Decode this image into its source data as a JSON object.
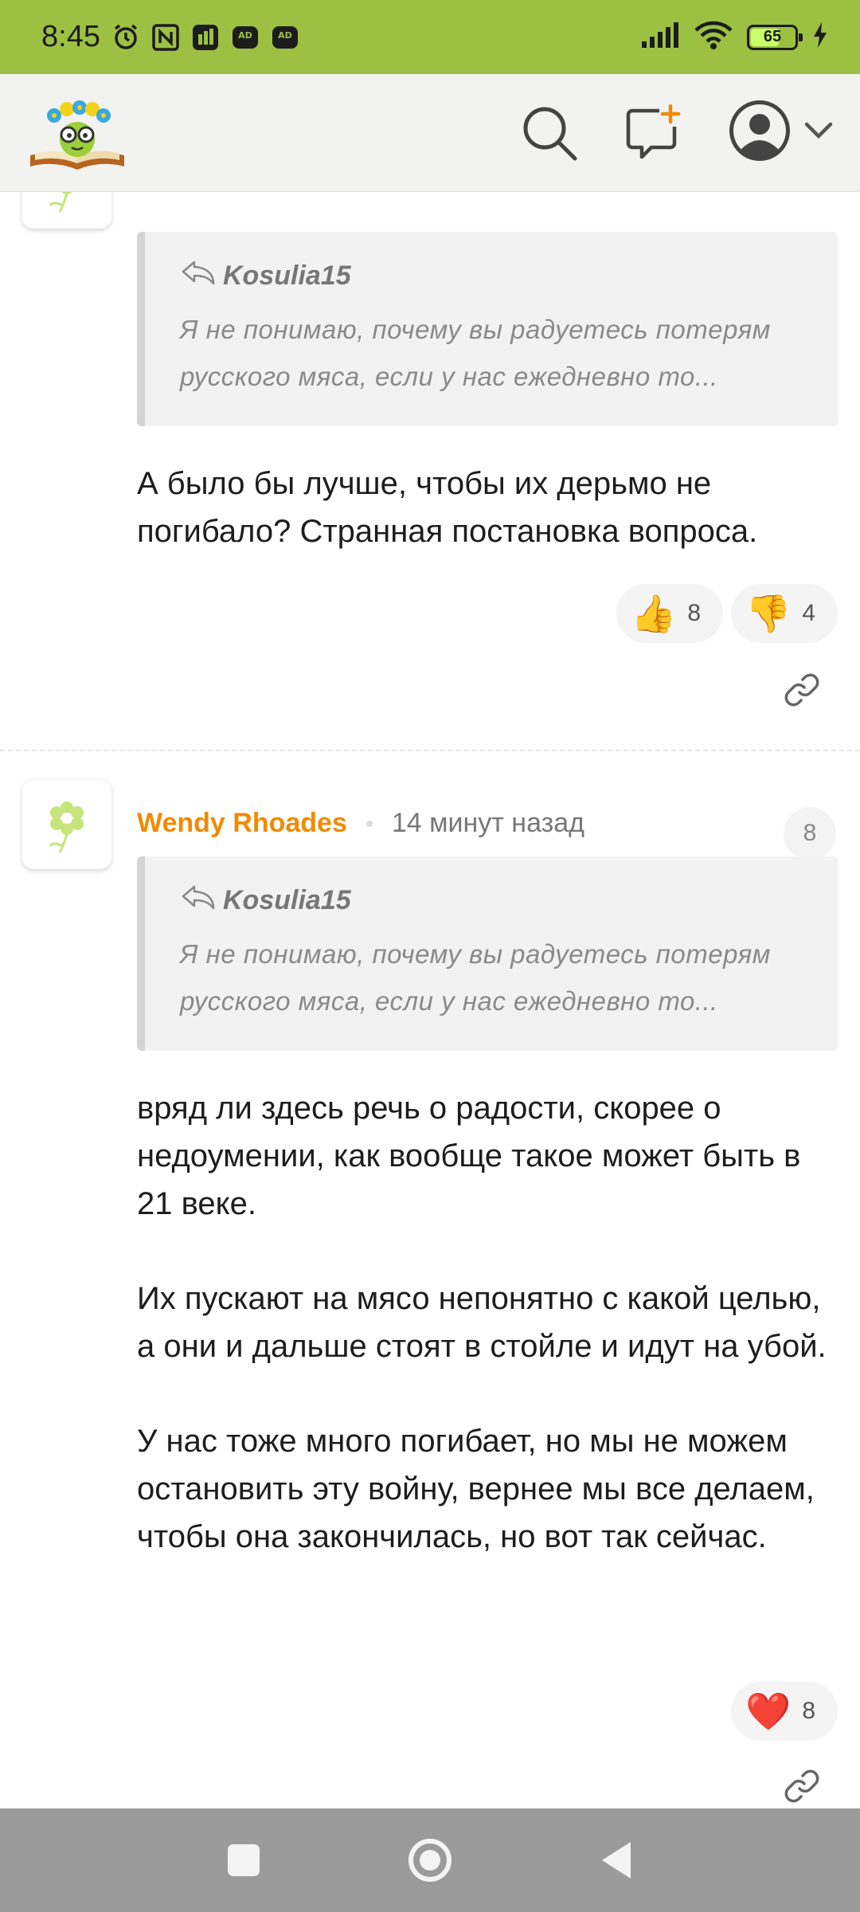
{
  "status_bar": {
    "time": "8:45",
    "battery": "65",
    "left_icons": [
      "alarm-icon",
      "nfc-icon",
      "app-icon",
      "ad-blocker-icon",
      "ad-blocker-icon"
    ],
    "right_icons": [
      "signal-icon",
      "wifi-icon",
      "battery-icon",
      "charging-icon"
    ]
  },
  "header": {
    "logo": "logo-icon",
    "search": "search-icon",
    "new_message": "new-message-icon",
    "profile": "avatar-icon",
    "dropdown": "chevron-down-icon"
  },
  "comments": [
    {
      "quote": {
        "author": "Kosulia15",
        "text": "Я не понимаю, почему вы радуетесь потерям русского мяса, если у нас ежедневно то..."
      },
      "body": [
        "А было бы лучше, чтобы их дерьмо не погибало? Странная постановка вопроса."
      ],
      "reactions": [
        {
          "icon": "thumbs-up-icon",
          "emoji": "👍",
          "count": "8"
        },
        {
          "icon": "thumbs-down-icon",
          "emoji": "👎",
          "count": "4"
        }
      ]
    },
    {
      "author": "Wendy Rhoades",
      "time": "14 минут назад",
      "count": "8",
      "quote": {
        "author": "Kosulia15",
        "text": "Я не понимаю, почему вы радуетесь потерям русского мяса, если у нас ежедневно то..."
      },
      "body": [
        "вряд ли здесь речь о радости, скорее о недоумении, как вообще такое может быть в 21 веке.",
        "Их пускают на мясо непонятно с какой целью, а они и дальше стоят в стойле и идут на убой.",
        "У нас тоже много погибает, но мы не можем остановить эту войну, вернее мы все делаем, чтобы она закончилась, но вот так сейчас."
      ],
      "reactions": [
        {
          "icon": "heart-icon",
          "emoji": "❤️",
          "count": "8"
        }
      ]
    }
  ],
  "colors": {
    "status_bar": "#9cc142",
    "author": "#f18a00",
    "nav_bar": "#9b9b9b"
  }
}
